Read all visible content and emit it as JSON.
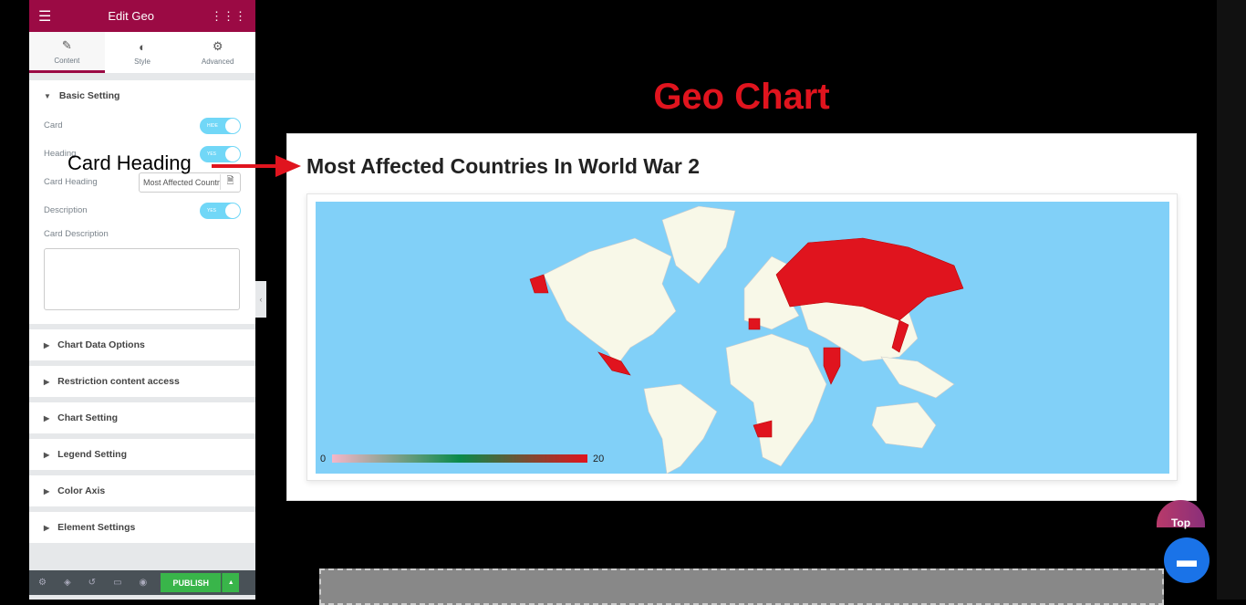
{
  "panel": {
    "title": "Edit Geo",
    "tabs": [
      {
        "label": "Content",
        "icon": "pencil-icon"
      },
      {
        "label": "Style",
        "icon": "contrast-icon"
      },
      {
        "label": "Advanced",
        "icon": "gear-icon"
      }
    ],
    "basic_setting": "Basic Setting",
    "fields": {
      "card": "Card",
      "card_toggle": "HIDE",
      "heading": "Heading",
      "heading_toggle": "YES",
      "card_heading": "Card Heading",
      "card_heading_value": "Most Affected Countries In World War 2",
      "description": "Description",
      "description_toggle": "YES",
      "card_description": "Card Description"
    },
    "sections": [
      "Chart Data Options",
      "Restriction content access",
      "Chart Setting",
      "Legend Setting",
      "Color Axis",
      "Element Settings"
    ],
    "publish": "PUBLISH"
  },
  "page": {
    "title": "Geo Chart",
    "annotation": "Card Heading",
    "top_button": "Top"
  },
  "chart_data": {
    "type": "geo",
    "title": "Most Affected Countries In World War 2",
    "highlighted_regions": [
      "Russia",
      "Germany",
      "India",
      "Mexico",
      "South Africa",
      "Japan",
      "Alaska"
    ],
    "color_axis": {
      "min": 0,
      "max": 20,
      "colors": [
        "#f4b6c8",
        "#0a8a4a",
        "#e0141e"
      ]
    },
    "colors": {
      "ocean": "#81d0f8",
      "land": "#f8f8e8",
      "highlight": "#e0141e"
    }
  }
}
